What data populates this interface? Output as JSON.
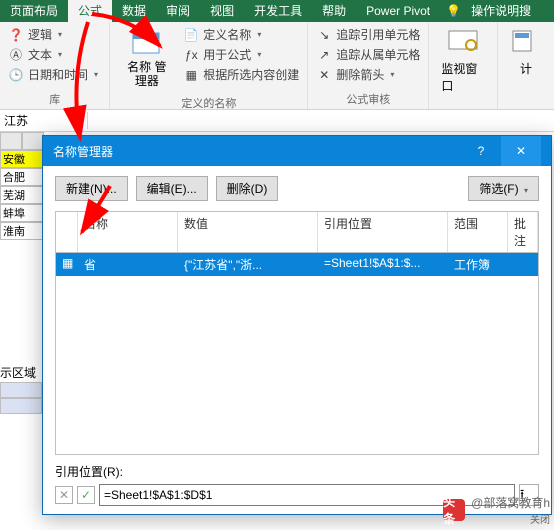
{
  "ribbon": {
    "tabs": [
      "页面布局",
      "公式",
      "数据",
      "审阅",
      "视图",
      "开发工具",
      "帮助",
      "Power Pivot"
    ],
    "active_tab_index": 1,
    "tell_me": "操作说明搜",
    "group1": {
      "items": [
        "逻辑",
        "文本",
        "日期和时间"
      ],
      "label": "库"
    },
    "group2": {
      "big": "名称\n管理器",
      "items": [
        "定义名称",
        "用于公式",
        "根据所选内容创建"
      ],
      "label": "定义的名称"
    },
    "group3": {
      "items": [
        "追踪引用单元格",
        "追踪从属单元格",
        "删除箭头"
      ],
      "label": "公式审核"
    },
    "group4": {
      "big": "监视窗口"
    },
    "group5": {
      "big": "计"
    }
  },
  "name_box": "江苏",
  "sheet_cells": [
    "安徽",
    "合肥",
    "芜湖",
    "蚌埠",
    "淮南"
  ],
  "side_label": "示区域",
  "dialog": {
    "title": "名称管理器",
    "btn_new": "新建(N)...",
    "btn_edit": "编辑(E)...",
    "btn_delete": "删除(D)",
    "btn_filter": "筛选(F)",
    "columns": {
      "name": "名称",
      "value": "数值",
      "ref": "引用位置",
      "scope": "范围",
      "note": "批注"
    },
    "row": {
      "name": "省",
      "value": "{\"江苏省\",\"浙...",
      "ref": "=Sheet1!$A$1:$...",
      "scope": "工作簿",
      "note": ""
    },
    "ref_label": "引用位置(R):",
    "ref_value": "=Sheet1!$A$1:$D$1"
  },
  "watermark": {
    "brand": "头条",
    "text": "@部落窝教育h",
    "close": "关闭"
  }
}
